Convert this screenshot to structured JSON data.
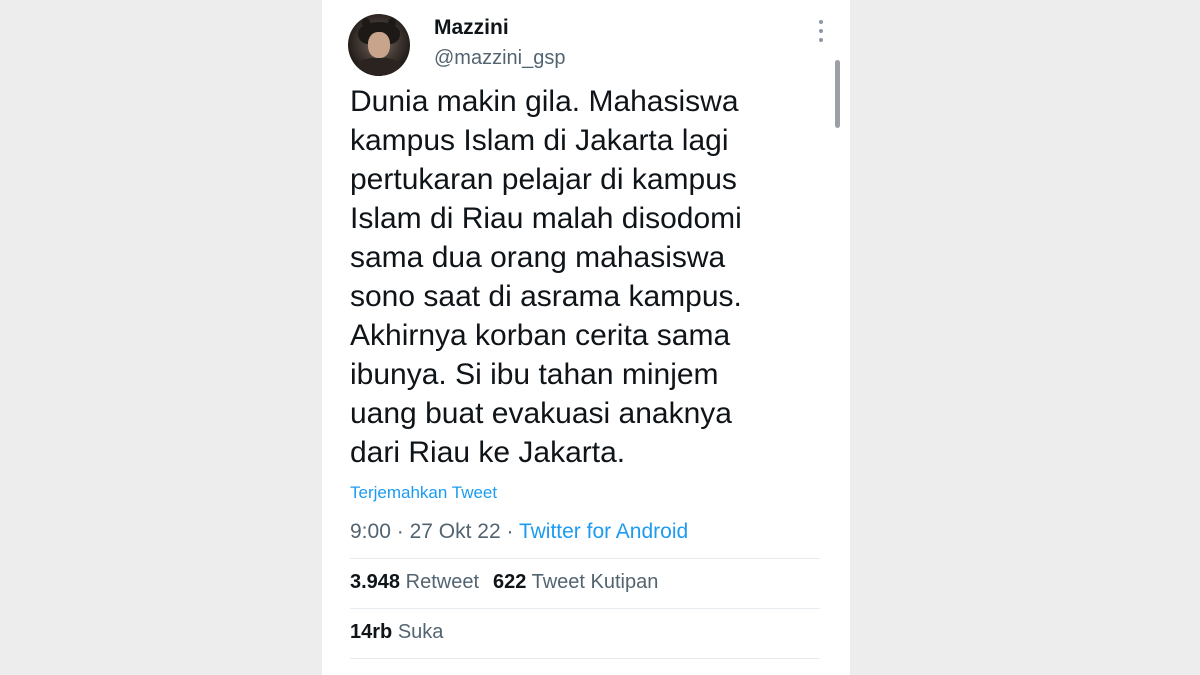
{
  "tweet": {
    "display_name": "Mazzini",
    "handle": "@mazzini_gsp",
    "text": "Dunia makin gila. Mahasiswa\nkampus Islam di Jakarta lagi\npertukaran pelajar di kampus\nIslam di Riau malah disodomi\nsama dua orang mahasiswa\nsono saat di asrama kampus.\nAkhirnya korban cerita sama\nibunya. Si ibu tahan minjem\nuang buat evakuasi anaknya\ndari Riau ke Jakarta.",
    "translate_label": "Terjemahkan Tweet",
    "time": "9:00",
    "date": "27 Okt 22",
    "separator": "·",
    "source": "Twitter for Android",
    "stats": {
      "retweets_count": "3.948",
      "retweets_label": "Retweet",
      "quotes_count": "622",
      "quotes_label": "Tweet Kutipan",
      "likes_count": "14rb",
      "likes_label": "Suka"
    }
  },
  "icons": {
    "avatar": "profile-photo",
    "more": "more-vertical-icon"
  },
  "colors": {
    "link": "#1d9bf0",
    "text": "#0f1419",
    "secondary": "#536471",
    "background": "#ededed",
    "card": "#ffffff"
  }
}
